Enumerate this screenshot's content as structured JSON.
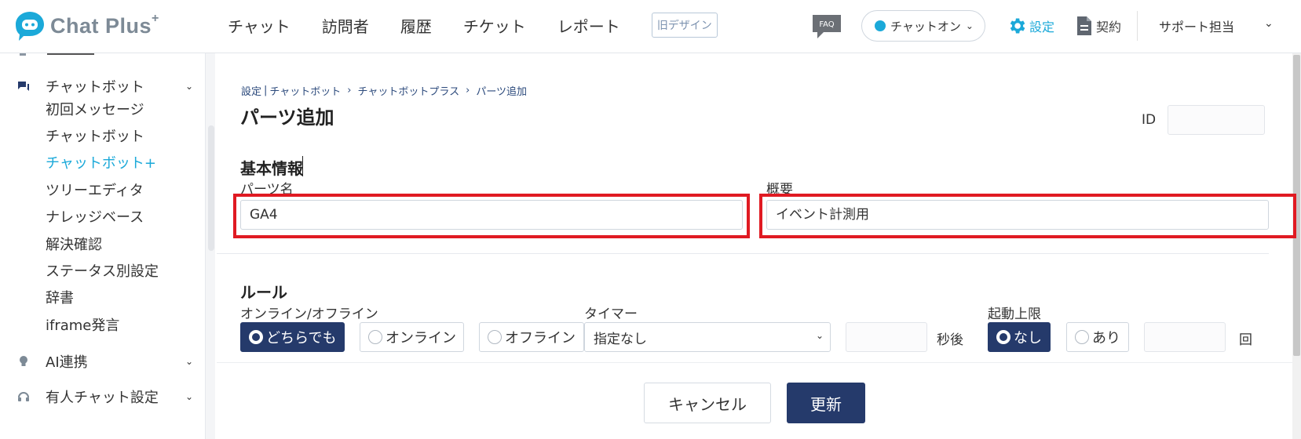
{
  "header": {
    "logo_text": "Chat Plus",
    "logo_sup": "+",
    "nav": [
      "チャット",
      "訪問者",
      "履歴",
      "チケット",
      "レポート"
    ],
    "old_design": "旧デザイン",
    "faq": "FAQ",
    "status": "チャットオン",
    "settings": "設定",
    "contract": "契約",
    "user": "サポート担当"
  },
  "sidebar": {
    "group_chatbot": "チャットボット",
    "items": [
      "初回メッセージ",
      "チャットボット",
      "チャットボット+",
      "ツリーエディタ",
      "ナレッジベース",
      "解決確認",
      "ステータス別設定",
      "辞書",
      "iframe発言"
    ],
    "active_index": 2,
    "group_ai": "AI連携",
    "group_manned": "有人チャット設定"
  },
  "breadcrumb": [
    "設定",
    "チャットボット",
    "チャットボットプラス",
    "パーツ追加"
  ],
  "page_title": "パーツ追加",
  "id_label": "ID",
  "id_value": "",
  "basic": {
    "title": "基本情報",
    "name_label": "パーツ名",
    "name_value": "GA4",
    "summary_label": "概要",
    "summary_value": "イベント計測用"
  },
  "rules": {
    "title": "ルール",
    "online_label": "オンライン/オフライン",
    "online_options": [
      "どちらでも",
      "オンライン",
      "オフライン"
    ],
    "online_selected": "どちらでも",
    "timer_label": "タイマー",
    "timer_value": "指定なし",
    "timer_unit": "秒後",
    "limit_label": "起動上限",
    "limit_options": [
      "なし",
      "あり"
    ],
    "limit_selected": "なし",
    "limit_unit": "回"
  },
  "buttons": {
    "cancel": "キャンセル",
    "update": "更新"
  },
  "colors": {
    "accent": "#1ba9d9",
    "navy": "#253a6b",
    "highlight": "#e01a22"
  }
}
